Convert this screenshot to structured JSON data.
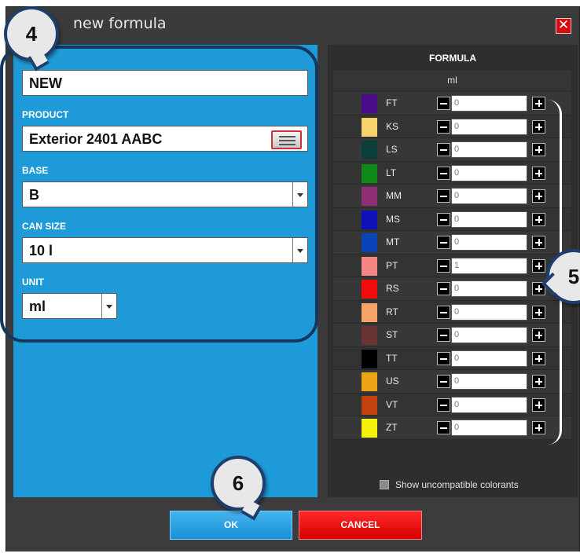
{
  "window": {
    "title": "new formula",
    "close_label": "✕"
  },
  "fields": {
    "name_value": "NEW",
    "product_label": "PRODUCT",
    "product_value": "Exterior 2401 AABC",
    "base_label": "BASE",
    "base_value": "B",
    "can_size_label": "CAN SIZE",
    "can_size_value": "10 l",
    "unit_label": "UNIT",
    "unit_value": "ml"
  },
  "formula": {
    "title": "FORMULA",
    "unit_header": "ml",
    "colorants": [
      {
        "code": "FT",
        "color": "#4b0c8a",
        "qty": "0"
      },
      {
        "code": "KS",
        "color": "#f7d46b",
        "qty": "0"
      },
      {
        "code": "LS",
        "color": "#0c3e3c",
        "qty": "0"
      },
      {
        "code": "LT",
        "color": "#0f8a19",
        "qty": "0"
      },
      {
        "code": "MM",
        "color": "#8e2f76",
        "qty": "0"
      },
      {
        "code": "MS",
        "color": "#0e12b8",
        "qty": "0"
      },
      {
        "code": "MT",
        "color": "#0a44b8",
        "qty": "0"
      },
      {
        "code": "PT",
        "color": "#f58686",
        "qty": "1"
      },
      {
        "code": "RS",
        "color": "#f20d0d",
        "qty": "0"
      },
      {
        "code": "RT",
        "color": "#f6a46a",
        "qty": "0"
      },
      {
        "code": "ST",
        "color": "#6a3434",
        "qty": "0"
      },
      {
        "code": "TT",
        "color": "#000000",
        "qty": "0"
      },
      {
        "code": "US",
        "color": "#eaa414",
        "qty": "0"
      },
      {
        "code": "VT",
        "color": "#c2410e",
        "qty": "0"
      },
      {
        "code": "ZT",
        "color": "#f4f20a",
        "qty": "0"
      }
    ],
    "show_uncompatible_label": "Show uncompatible colorants",
    "show_uncompatible_checked": false
  },
  "buttons": {
    "ok": "OK",
    "cancel": "CANCEL"
  },
  "callouts": {
    "left_fields": "4",
    "colorant_list": "5",
    "ok_button": "6"
  }
}
